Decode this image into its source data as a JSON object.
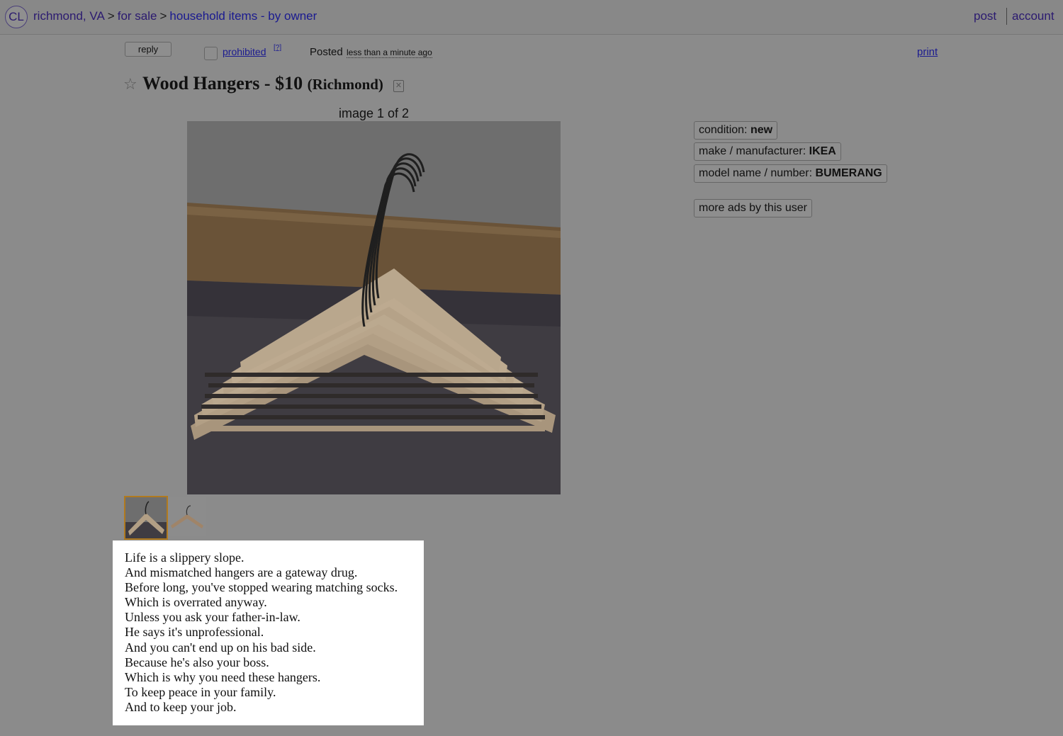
{
  "header": {
    "logo": "CL",
    "breadcrumbs": [
      "richmond, VA",
      "for sale",
      "household items - by owner"
    ],
    "separator": ">",
    "post_label": "post",
    "account_label": "account"
  },
  "actions": {
    "reply_label": "reply",
    "prohibited_label": "prohibited",
    "help_label": "[?]",
    "posted_label": "Posted",
    "posted_time": "less than a minute ago",
    "print_label": "print"
  },
  "posting": {
    "title": "Wood Hangers - $10",
    "location": "(Richmond)"
  },
  "gallery": {
    "counter": "image 1 of 2",
    "current_image": 1,
    "total_images": 2
  },
  "attributes": [
    {
      "label": "condition: ",
      "value": "new"
    },
    {
      "label": "make / manufacturer: ",
      "value": "IKEA"
    },
    {
      "label": "model name / number: ",
      "value": "BUMERANG"
    }
  ],
  "more_ads_label": "more ads by this user",
  "description": [
    "Life is a slippery slope.",
    "And mismatched hangers are a gateway drug.",
    "Before long, you've stopped wearing matching socks.",
    "Which is overrated anyway.",
    "Unless you ask your father-in-law.",
    "He says it's unprofessional.",
    "And you can't end up on his bad side.",
    "Because he's also your boss.",
    "Which is why you need these hangers.",
    "To keep peace in your family.",
    "And to keep your job."
  ],
  "icons": {
    "star": "star-outline-icon",
    "hide": "hide-x-icon"
  }
}
